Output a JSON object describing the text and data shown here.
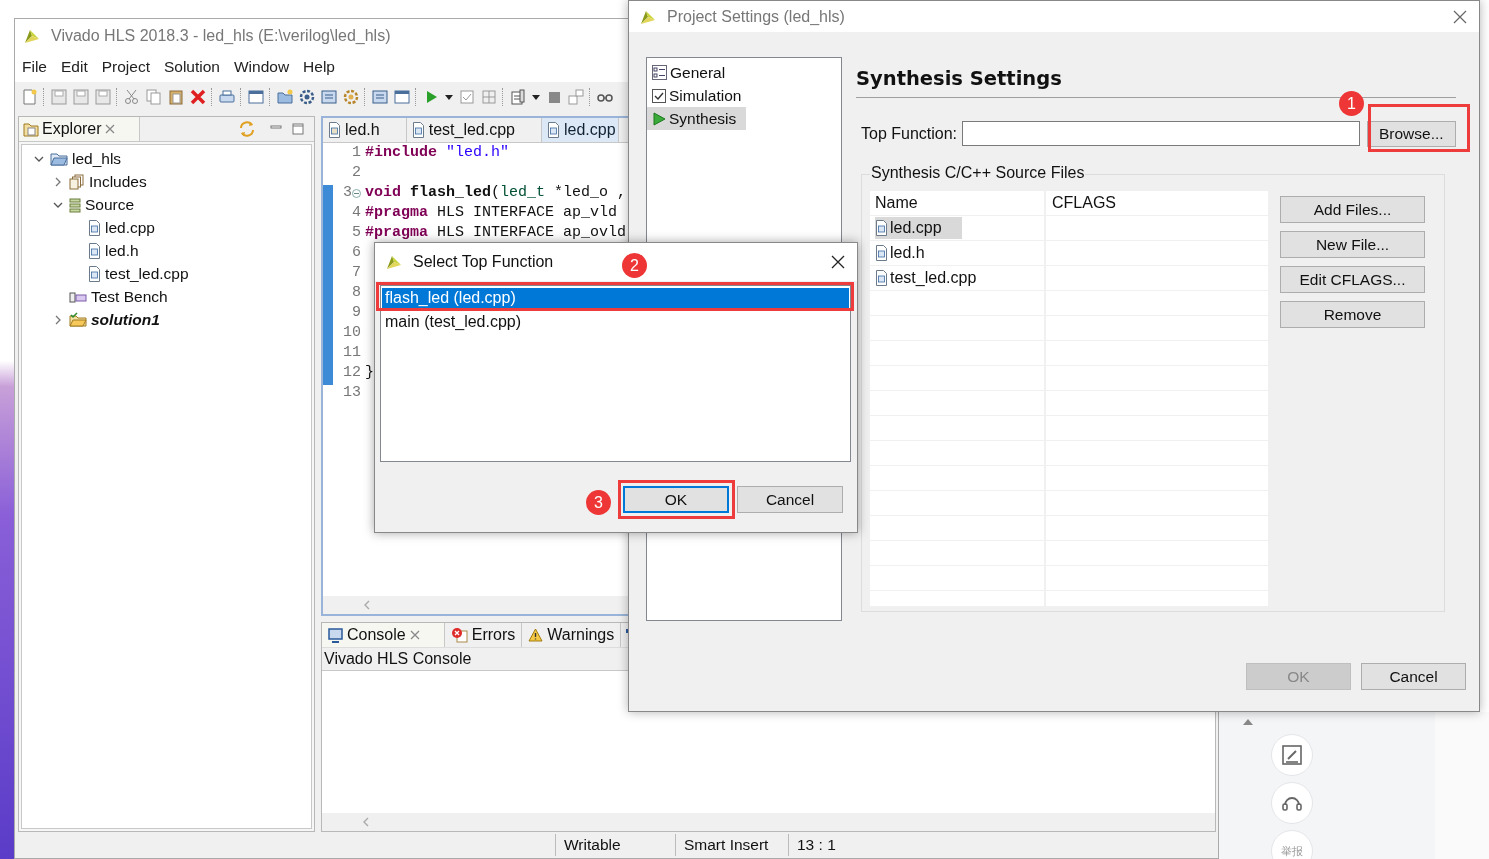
{
  "main_window": {
    "title": "Vivado HLS 2018.3 - led_hls (E:\\verilog\\led_hls)",
    "menu": [
      "File",
      "Edit",
      "Project",
      "Solution",
      "Window",
      "Help"
    ],
    "explorer": {
      "title": "Explorer",
      "tree": [
        {
          "label": "led_hls",
          "kind": "project",
          "expanded": true,
          "active": false,
          "children": [
            {
              "label": "Includes",
              "kind": "includes",
              "expanded": false,
              "active": false
            },
            {
              "label": "Source",
              "kind": "source",
              "expanded": true,
              "active": false,
              "children": [
                {
                  "label": "led.cpp",
                  "kind": "file",
                  "active": false
                },
                {
                  "label": "led.h",
                  "kind": "file",
                  "active": false
                },
                {
                  "label": "test_led.cpp",
                  "kind": "file",
                  "active": false
                }
              ]
            },
            {
              "label": "Test Bench",
              "kind": "testbench",
              "active": false
            },
            {
              "label": "solution1",
              "kind": "solution",
              "expanded": false,
              "active": true
            }
          ]
        }
      ]
    },
    "editor": {
      "tabs": [
        {
          "label": "led.h",
          "kind": "header",
          "selected": false
        },
        {
          "label": "test_led.cpp",
          "kind": "source",
          "selected": false
        },
        {
          "label": "led.cpp",
          "kind": "source",
          "selected": true
        }
      ],
      "lines": [
        {
          "number": "1",
          "tokens": [
            {
              "text": "#include",
              "kind": "keyword"
            },
            {
              "text": " \"led.h\"",
              "kind": "string"
            }
          ]
        },
        {
          "number": "2"
        },
        {
          "number": "3",
          "folded": false,
          "tokens": [
            {
              "text": "void",
              "kind": "keyword"
            },
            {
              "text": " flash_led",
              "kind": "function"
            },
            {
              "text": "(",
              "kind": "plain"
            },
            {
              "text": "led_t",
              "kind": "type"
            },
            {
              "text": " *led_o ,",
              "kind": "plain"
            }
          ]
        },
        {
          "number": "4",
          "tokens": [
            {
              "text": "#pragma",
              "kind": "keyword"
            },
            {
              "text": " HLS INTERFACE ap_vld",
              "kind": "plain"
            }
          ]
        },
        {
          "number": "5",
          "tokens": [
            {
              "text": "#pragma",
              "kind": "keyword"
            },
            {
              "text": " HLS INTERFACE ap_ovld",
              "kind": "plain"
            }
          ]
        },
        {
          "number": "6"
        },
        {
          "number": "7"
        },
        {
          "number": "8"
        },
        {
          "number": "9"
        },
        {
          "number": "10"
        },
        {
          "number": "11"
        },
        {
          "number": "12",
          "tokens": [
            {
              "text": "}",
              "kind": "plain"
            }
          ]
        },
        {
          "number": "13"
        }
      ]
    },
    "console": {
      "tabs": [
        {
          "label": "Console",
          "kind": "console",
          "selected": true
        },
        {
          "label": "Errors",
          "kind": "errors",
          "selected": false
        },
        {
          "label": "Warnings",
          "kind": "warnings",
          "selected": false
        }
      ],
      "header": "Vivado HLS Console"
    },
    "status_bar": [
      "Writable",
      "Smart Insert",
      "13 : 1"
    ]
  },
  "project_settings": {
    "title": "Project Settings (led_hls)",
    "categories": [
      {
        "label": "General",
        "kind": "general",
        "selected": false
      },
      {
        "label": "Simulation",
        "kind": "simulation",
        "selected": false
      },
      {
        "label": "Synthesis",
        "kind": "synthesis",
        "selected": true
      }
    ],
    "heading": "Synthesis Settings",
    "top_function": {
      "label": "Top Function:"
    },
    "browse_button": "Browse...",
    "group_title": "Synthesis C/C++ Source Files",
    "table": {
      "columns": [
        "Name",
        "CFLAGS"
      ],
      "rows": [
        {
          "name": "led.cpp",
          "selected": true
        },
        {
          "name": "led.h",
          "selected": false
        },
        {
          "name": "test_led.cpp",
          "selected": false
        }
      ]
    },
    "side_buttons": [
      "Add Files...",
      "New File...",
      "Edit CFLAGS...",
      "Remove"
    ],
    "buttons": [
      {
        "label": "OK",
        "disabled": true
      },
      {
        "label": "Cancel",
        "disabled": false
      }
    ]
  },
  "select_dialog": {
    "title": "Select Top Function",
    "items": [
      {
        "label": "flash_led (led.cpp)",
        "selected": true
      },
      {
        "label": "main (test_led.cpp)",
        "selected": false
      }
    ],
    "buttons": [
      {
        "label": "OK",
        "focused": true
      },
      {
        "label": "Cancel",
        "focused": false
      }
    ]
  },
  "annotations": [
    {
      "number": "1"
    },
    {
      "number": "2"
    },
    {
      "number": "3"
    }
  ],
  "background_page": {
    "report_label": "举报"
  }
}
